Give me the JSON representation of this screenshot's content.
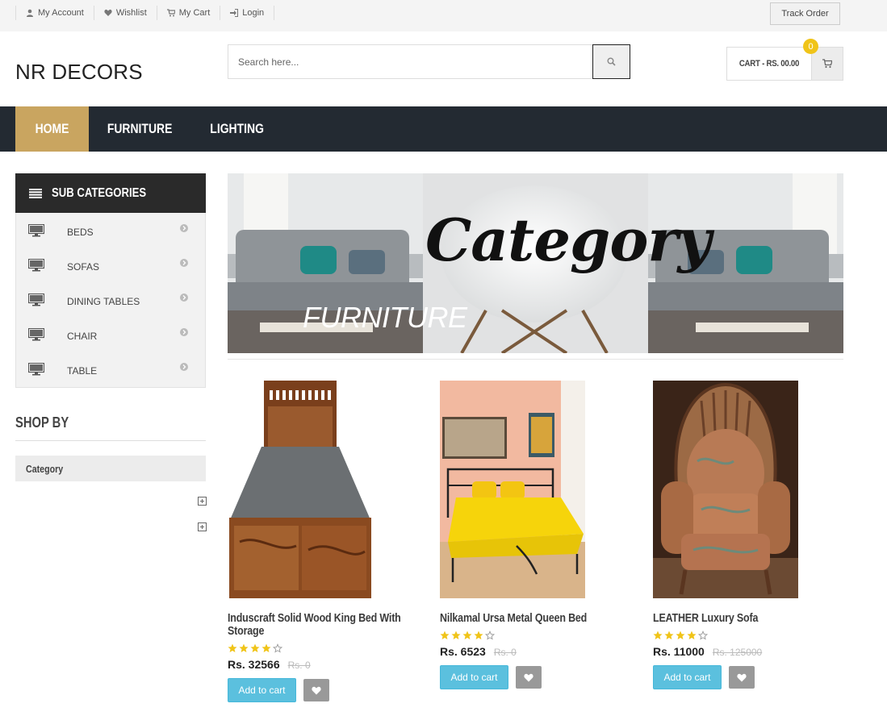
{
  "topbar": {
    "links": [
      {
        "label": "My Account",
        "icon": "user-icon"
      },
      {
        "label": "Wishlist",
        "icon": "heart-icon"
      },
      {
        "label": "My Cart",
        "icon": "cart-icon"
      },
      {
        "label": "Login",
        "icon": "login-icon"
      }
    ],
    "track_order": "Track Order"
  },
  "header": {
    "logo": "NR DECORS",
    "search_placeholder": "Search here...",
    "cart_label": "CART - RS. 00.00",
    "cart_count": "0"
  },
  "nav": {
    "items": [
      "HOME",
      "FURNITURE",
      "LIGHTING"
    ],
    "active": "HOME"
  },
  "sidebar": {
    "subcategories_title": "SUB CATEGORIES",
    "subcategories": [
      "BEDS",
      "SOFAS",
      "DINING TABLES",
      "CHAIR",
      "TABLE"
    ],
    "shop_by_title": "SHOP BY",
    "category_filter": "Category"
  },
  "banner": {
    "title": "Category",
    "subtitle": "FURNITURE"
  },
  "products": [
    {
      "title": "Induscraft Solid Wood King Bed With Storage",
      "rating": 4,
      "price": "Rs. 32566",
      "old_price": "Rs. 0",
      "add_label": "Add to cart"
    },
    {
      "title": "Nilkamal Ursa Metal Queen Bed",
      "rating": 4,
      "price": "Rs. 6523",
      "old_price": "Rs. 0",
      "add_label": "Add to cart"
    },
    {
      "title": "LEATHER Luxury Sofa",
      "rating": 4,
      "price": "Rs. 11000",
      "old_price": "Rs. 125000",
      "add_label": "Add to cart"
    }
  ],
  "colors": {
    "nav_bg": "#232a32",
    "nav_active": "#c9a560",
    "badge": "#f0c419",
    "add_to_cart": "#5bc0de",
    "star": "#f0c419"
  }
}
